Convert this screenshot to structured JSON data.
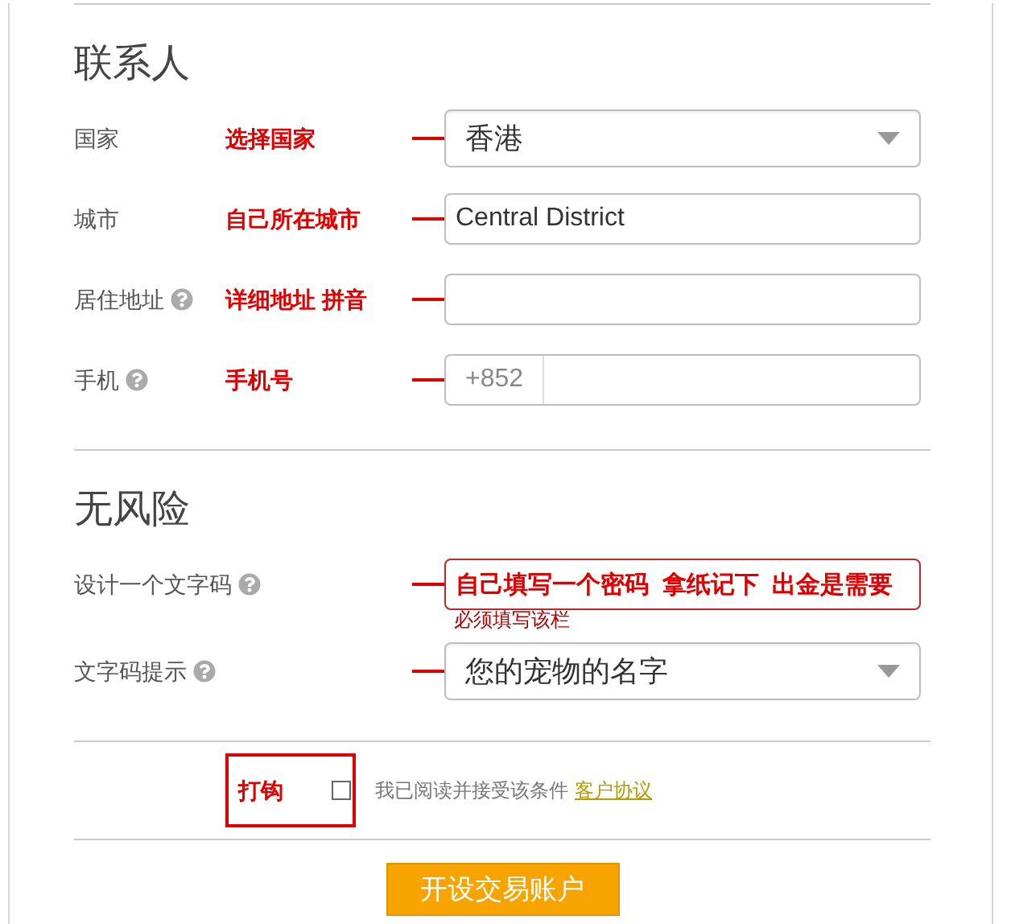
{
  "sections": [
    {
      "title": "联系人",
      "fields": [
        {
          "kind": "select",
          "label": "国家",
          "help": false,
          "annotation": "选择国家",
          "value": "香港"
        },
        {
          "kind": "text",
          "label": "城市",
          "help": false,
          "annotation": "自己所在城市",
          "value": "Central District"
        },
        {
          "kind": "text",
          "label": "居住地址",
          "help": true,
          "annotation": "详细地址  拼音"
        },
        {
          "kind": "phone",
          "label": "手机",
          "help": true,
          "annotation": "手机号",
          "prefix": "+852"
        }
      ]
    },
    {
      "title": "无风险",
      "fields": [
        {
          "kind": "text",
          "label": "设计一个文字码",
          "help": true,
          "value": "自己填写一个密码  拿纸记下  出金是需要",
          "error": "必须填写该栏"
        },
        {
          "kind": "select",
          "label": "文字码提示",
          "help": true,
          "value": "您的宠物的名字"
        }
      ]
    }
  ],
  "agreement": {
    "annotation": "打钩",
    "checked": false,
    "text": "我已阅读并接受该条件",
    "link": "客户协议"
  },
  "submit": "开设交易账户"
}
